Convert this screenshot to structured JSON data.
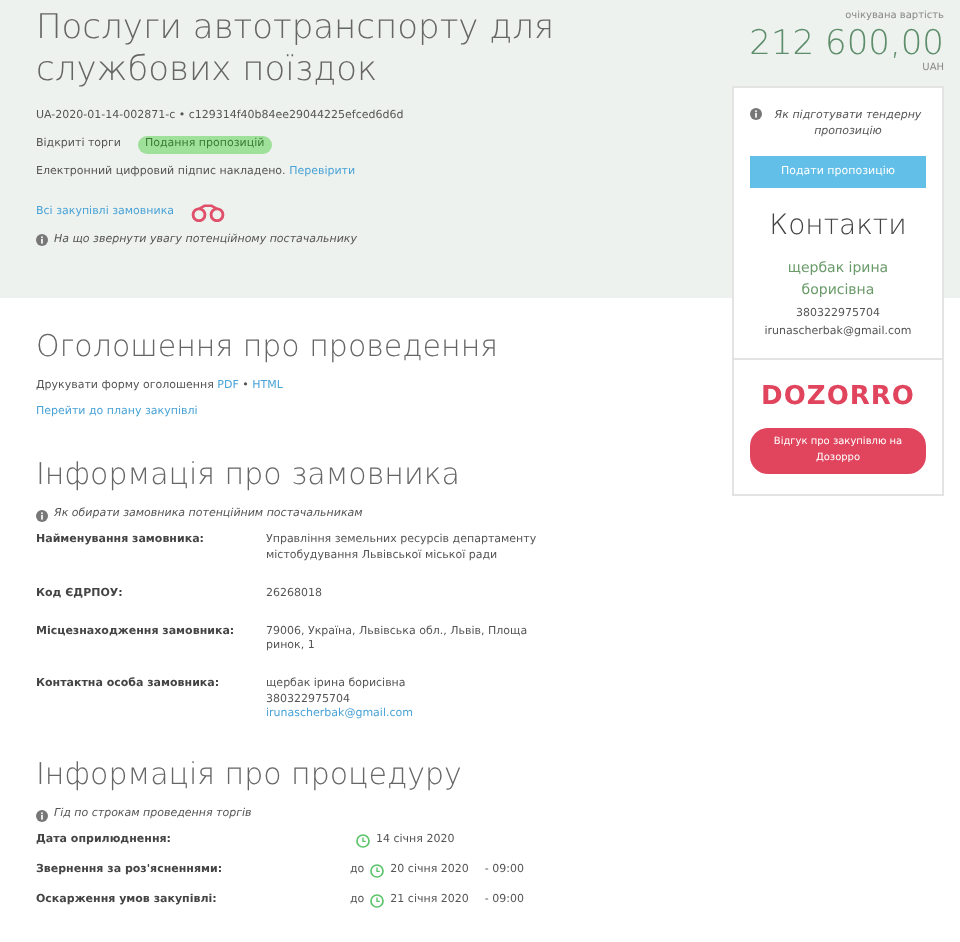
{
  "header": {
    "title": "Послуги автотранспорту для службових поїздок",
    "tender_id": "UA-2020-01-14-002871-c • c129314f40b84ee29044225efced6d6d",
    "procedure_type": "Відкриті торги",
    "status": "Подання пропозицій",
    "signature_text": "Електронний цифровий підпис накладено.",
    "signature_link": "Перевірити",
    "customer_link": "Всі закупівлі замовника",
    "hint": "На що звернути увагу потенційному постачальнику"
  },
  "price": {
    "label": "очікувана вартість",
    "amount": "212 600,00",
    "currency": "UAH"
  },
  "sidebar": {
    "hint": "Як підготувати тендерну пропозицію",
    "submit_button": "Подати пропозицію",
    "contacts_title": "Контакти",
    "contact_name": "щербак ірина борисівна",
    "contact_phone": "380322975704",
    "contact_email": "irunascherbak@gmail.com",
    "logo": "DOZORRO",
    "monitoring_button": "Відгук про закупівлю на Дозорро"
  },
  "announcement": {
    "title": "Оголошення про проведення",
    "print_label": "Друкувати форму оголошення",
    "print_links": [
      "PDF",
      "HTML"
    ],
    "print_separator": "•",
    "plan_link": "Перейти до плану закупівлі"
  },
  "customer": {
    "title": "Інформація про замовника",
    "hint": "Як обирати замовника потенційним постачальникам",
    "rows": [
      {
        "label": "Найменування замовника:",
        "values": [
          {
            "kind": "text",
            "text": "Управління земельних ресурсів департаменту містобудування Львівської міської ради"
          }
        ]
      },
      {
        "label": "Код ЄДРПОУ:",
        "values": [
          {
            "kind": "text",
            "text": "26268018"
          }
        ]
      },
      {
        "label": "Місцезнаходження замовника:",
        "values": [
          {
            "kind": "text",
            "text": "79006, Україна, Львівська обл., Львів, Площа ринок, 1"
          }
        ]
      },
      {
        "label": "Контактна особа замовника:",
        "values": [
          {
            "kind": "text",
            "text": "щербак ірина борисівна"
          },
          {
            "kind": "text",
            "text": "380322975704"
          },
          {
            "kind": "link",
            "text": "irunascherbak@gmail.com"
          }
        ]
      }
    ]
  },
  "procedure": {
    "title": "Інформація про процедуру",
    "hint": "Гід по строкам проведення торгів",
    "rows": [
      {
        "label": "Дата оприлюднення:",
        "date": "14 січня 2020"
      },
      {
        "label": "Звернення за роз'ясненнями:",
        "prefix": "до",
        "date": "20 січня 2020",
        "time": "- 09:00"
      },
      {
        "label": "Оскарження умов закупівлі:",
        "prefix": "до",
        "date": "21 січня 2020",
        "time": "- 09:00"
      }
    ]
  }
}
